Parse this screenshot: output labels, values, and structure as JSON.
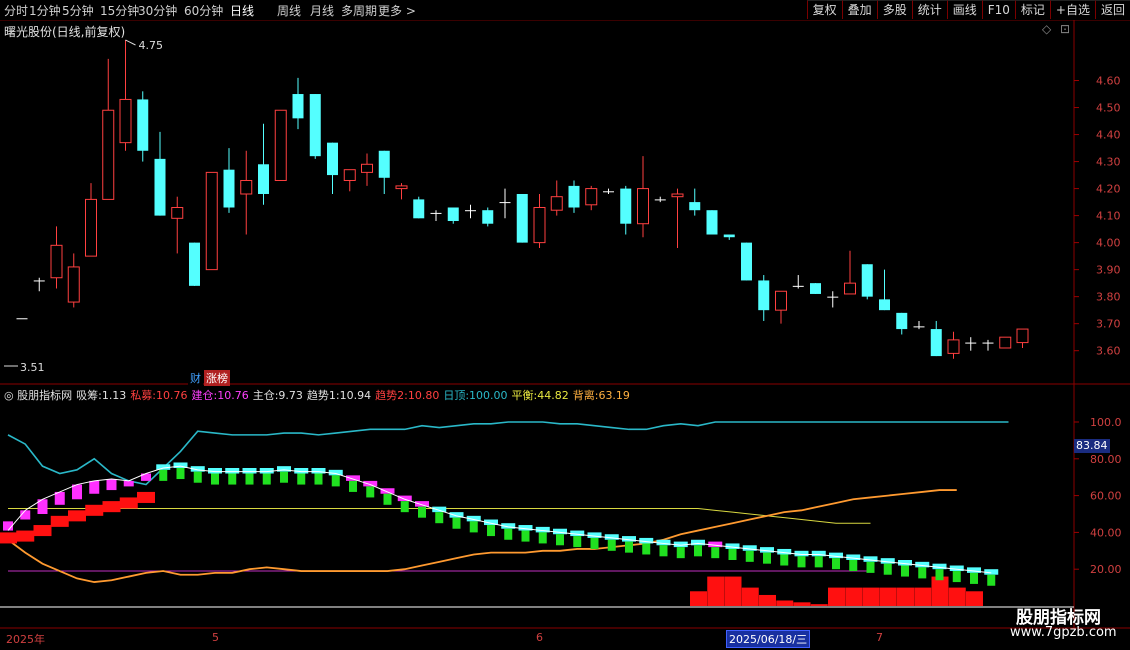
{
  "periods": [
    "分时",
    "1分钟",
    "5分钟",
    "15分钟",
    "30分钟",
    "60分钟",
    "日线",
    "周线",
    "月线",
    "多周期",
    "更多 >"
  ],
  "active_period": "日线",
  "right_buttons": [
    "复权",
    "叠加",
    "多股",
    "统计",
    "画线",
    "F10",
    "标记",
    "+自选",
    "返回"
  ],
  "title": "曙光股份(日线,前复权)",
  "title_controls": [
    "◇",
    "⊡"
  ],
  "price_axis": [
    "4.60",
    "4.50",
    "4.40",
    "4.30",
    "4.20",
    "4.10",
    "4.00",
    "3.90",
    "3.80",
    "3.70",
    "3.60"
  ],
  "high_marker": "4.75",
  "low_marker": "3.51",
  "badges": {
    "cai": "财",
    "zhangting": "涨榜"
  },
  "indicator": {
    "name": "股朋指标网",
    "items": [
      {
        "label": "吸筹:",
        "value": "1.13",
        "color": "#e0e0e0"
      },
      {
        "label": "私募:",
        "value": "10.76",
        "color": "#ff4040"
      },
      {
        "label": "建仓:",
        "value": "10.76",
        "color": "#ff40ff"
      },
      {
        "label": "主仓:",
        "value": "9.73",
        "color": "#e0e0e0"
      },
      {
        "label": "趋势1:",
        "value": "10.94",
        "color": "#e0e0e0"
      },
      {
        "label": "趋势2:",
        "value": "10.80",
        "color": "#ff4040"
      },
      {
        "label": "日顶:",
        "value": "100.00",
        "color": "#2ab8c8"
      },
      {
        "label": "平衡:",
        "value": "44.82",
        "color": "#e8e840"
      },
      {
        "label": "背离:",
        "value": "63.19",
        "color": "#ffb040"
      }
    ]
  },
  "ind_axis": [
    "100.0",
    "80.00",
    "60.00",
    "40.00",
    "20.00"
  ],
  "ind_current": "83.84",
  "x_labels": [
    {
      "text": "2025年"
    },
    {
      "text": "5"
    },
    {
      "text": "6"
    },
    {
      "text": "7"
    }
  ],
  "x_cursor_date": "2025/06/18/三",
  "watermark": {
    "line1": "股朋指标网",
    "line2": "www.7gpzb.com"
  },
  "chart_data": {
    "type": "candlestick",
    "y_range": [
      3.51,
      4.75
    ],
    "candles": [
      {
        "o": 3.72,
        "c": 3.72,
        "h": 3.72,
        "l": 3.72
      },
      {
        "o": 3.86,
        "c": 3.86,
        "h": 3.87,
        "l": 3.82
      },
      {
        "o": 3.87,
        "c": 3.99,
        "h": 4.06,
        "l": 3.83
      },
      {
        "o": 3.78,
        "c": 3.91,
        "h": 3.96,
        "l": 3.76
      },
      {
        "o": 3.95,
        "c": 4.16,
        "h": 4.22,
        "l": 3.95
      },
      {
        "o": 4.16,
        "c": 4.49,
        "h": 4.68,
        "l": 4.16
      },
      {
        "o": 4.37,
        "c": 4.53,
        "h": 4.75,
        "l": 4.34
      },
      {
        "o": 4.53,
        "c": 4.34,
        "h": 4.56,
        "l": 4.3
      },
      {
        "o": 4.31,
        "c": 4.1,
        "h": 4.41,
        "l": 4.1
      },
      {
        "o": 4.09,
        "c": 4.13,
        "h": 4.17,
        "l": 3.96
      },
      {
        "o": 4.0,
        "c": 3.84,
        "h": 4.0,
        "l": 3.84
      },
      {
        "o": 3.9,
        "c": 4.26,
        "h": 4.26,
        "l": 3.9
      },
      {
        "o": 4.27,
        "c": 4.13,
        "h": 4.35,
        "l": 4.11
      },
      {
        "o": 4.18,
        "c": 4.23,
        "h": 4.34,
        "l": 4.03
      },
      {
        "o": 4.29,
        "c": 4.18,
        "h": 4.44,
        "l": 4.14
      },
      {
        "o": 4.23,
        "c": 4.49,
        "h": 4.49,
        "l": 4.23
      },
      {
        "o": 4.55,
        "c": 4.46,
        "h": 4.61,
        "l": 4.42
      },
      {
        "o": 4.55,
        "c": 4.32,
        "h": 4.55,
        "l": 4.31
      },
      {
        "o": 4.37,
        "c": 4.25,
        "h": 4.37,
        "l": 4.18
      },
      {
        "o": 4.23,
        "c": 4.27,
        "h": 4.27,
        "l": 4.19
      },
      {
        "o": 4.26,
        "c": 4.29,
        "h": 4.33,
        "l": 4.21
      },
      {
        "o": 4.34,
        "c": 4.24,
        "h": 4.34,
        "l": 4.18
      },
      {
        "o": 4.2,
        "c": 4.21,
        "h": 4.22,
        "l": 4.16
      },
      {
        "o": 4.16,
        "c": 4.09,
        "h": 4.17,
        "l": 4.09
      },
      {
        "o": 4.11,
        "c": 4.11,
        "h": 4.12,
        "l": 4.08
      },
      {
        "o": 4.13,
        "c": 4.08,
        "h": 4.13,
        "l": 4.07
      },
      {
        "o": 4.12,
        "c": 4.12,
        "h": 4.14,
        "l": 4.09
      },
      {
        "o": 4.12,
        "c": 4.07,
        "h": 4.13,
        "l": 4.06
      },
      {
        "o": 4.15,
        "c": 4.15,
        "h": 4.2,
        "l": 4.09
      },
      {
        "o": 4.18,
        "c": 4.0,
        "h": 4.18,
        "l": 4.0
      },
      {
        "o": 4.0,
        "c": 4.13,
        "h": 4.18,
        "l": 3.98
      },
      {
        "o": 4.12,
        "c": 4.17,
        "h": 4.23,
        "l": 4.1
      },
      {
        "o": 4.21,
        "c": 4.13,
        "h": 4.23,
        "l": 4.11
      },
      {
        "o": 4.14,
        "c": 4.2,
        "h": 4.21,
        "l": 4.12
      },
      {
        "o": 4.19,
        "c": 4.19,
        "h": 4.2,
        "l": 4.18
      },
      {
        "o": 4.2,
        "c": 4.07,
        "h": 4.21,
        "l": 4.03
      },
      {
        "o": 4.07,
        "c": 4.2,
        "h": 4.32,
        "l": 4.02
      },
      {
        "o": 4.16,
        "c": 4.16,
        "h": 4.17,
        "l": 4.15
      },
      {
        "o": 4.17,
        "c": 4.18,
        "h": 4.2,
        "l": 3.98
      },
      {
        "o": 4.15,
        "c": 4.12,
        "h": 4.2,
        "l": 4.1
      },
      {
        "o": 4.12,
        "c": 4.03,
        "h": 4.12,
        "l": 4.03
      },
      {
        "o": 4.03,
        "c": 4.02,
        "h": 4.03,
        "l": 4.01
      },
      {
        "o": 4.0,
        "c": 3.86,
        "h": 4.0,
        "l": 3.86
      },
      {
        "o": 3.86,
        "c": 3.75,
        "h": 3.88,
        "l": 3.71
      },
      {
        "o": 3.75,
        "c": 3.82,
        "h": 3.82,
        "l": 3.7
      },
      {
        "o": 3.84,
        "c": 3.84,
        "h": 3.88,
        "l": 3.83
      },
      {
        "o": 3.85,
        "c": 3.81,
        "h": 3.85,
        "l": 3.81
      },
      {
        "o": 3.8,
        "c": 3.8,
        "h": 3.82,
        "l": 3.76
      },
      {
        "o": 3.81,
        "c": 3.85,
        "h": 3.97,
        "l": 3.81
      },
      {
        "o": 3.92,
        "c": 3.8,
        "h": 3.92,
        "l": 3.79
      },
      {
        "o": 3.79,
        "c": 3.75,
        "h": 3.9,
        "l": 3.75
      },
      {
        "o": 3.74,
        "c": 3.68,
        "h": 3.74,
        "l": 3.66
      },
      {
        "o": 3.69,
        "c": 3.69,
        "h": 3.71,
        "l": 3.68
      },
      {
        "o": 3.68,
        "c": 3.58,
        "h": 3.71,
        "l": 3.58
      },
      {
        "o": 3.59,
        "c": 3.64,
        "h": 3.67,
        "l": 3.57
      },
      {
        "o": 3.63,
        "c": 3.63,
        "h": 3.65,
        "l": 3.6
      },
      {
        "o": 3.63,
        "c": 3.63,
        "h": 3.64,
        "l": 3.6
      },
      {
        "o": 3.61,
        "c": 3.65,
        "h": 3.65,
        "l": 3.61
      },
      {
        "o": 3.63,
        "c": 3.68,
        "h": 3.68,
        "l": 3.61
      }
    ],
    "indicator_range": [
      0,
      100
    ],
    "ribbon_top": [
      41,
      52,
      58,
      62,
      66,
      68,
      69,
      68,
      72,
      75,
      76,
      74,
      73,
      73,
      73,
      73,
      74,
      73,
      73,
      72,
      69,
      66,
      62,
      58,
      55,
      52,
      49,
      47,
      45,
      43,
      42,
      41,
      40,
      39,
      38,
      37,
      36,
      35,
      34,
      33,
      34,
      33,
      32,
      31,
      30,
      29,
      28,
      28,
      27,
      26,
      25,
      24,
      23,
      22,
      21,
      20,
      19,
      18
    ],
    "ribbon_bottom": [
      46,
      47,
      50,
      55,
      58,
      61,
      63,
      65,
      68,
      70,
      71,
      73,
      71,
      71,
      71,
      71,
      71,
      72,
      72,
      71,
      70,
      68,
      64,
      60,
      55,
      50,
      45,
      42,
      39,
      36,
      35,
      34,
      33,
      32,
      32,
      32,
      33,
      33,
      32,
      32,
      33,
      33,
      31,
      27,
      24,
      23,
      22,
      21,
      21,
      21,
      21,
      20,
      20,
      19,
      18,
      17,
      16,
      15
    ],
    "cyan_line": [
      93,
      88,
      76,
      72,
      74,
      80,
      72,
      68,
      66,
      75,
      84,
      95,
      94,
      93,
      93,
      93,
      94,
      94,
      93,
      94,
      95,
      96,
      96,
      96,
      98,
      97,
      98,
      99,
      99,
      100,
      100,
      100,
      99,
      99,
      98,
      97,
      96,
      96,
      98,
      99,
      98,
      100,
      100,
      100,
      100,
      100,
      100,
      100,
      100,
      100,
      100,
      100,
      100,
      100,
      100,
      100,
      100,
      100,
      100
    ],
    "orange_line": [
      36,
      29,
      23,
      19,
      15,
      13,
      14,
      16,
      18,
      19,
      17,
      17,
      18,
      18,
      20,
      21,
      20,
      19,
      19,
      19,
      19,
      19,
      19,
      20,
      22,
      24,
      26,
      28,
      29,
      29,
      29,
      30,
      30,
      31,
      31,
      32,
      33,
      34,
      36,
      39,
      41,
      43,
      45,
      47,
      49,
      51,
      52,
      54,
      56,
      58,
      59,
      60,
      61,
      62,
      63,
      63
    ],
    "yellow_line": [
      53,
      53,
      53,
      53,
      53,
      53,
      53,
      53,
      53,
      53,
      53,
      53,
      53,
      53,
      53,
      53,
      53,
      53,
      53,
      53,
      53,
      53,
      53,
      53,
      53,
      53,
      53,
      53,
      53,
      53,
      53,
      53,
      53,
      53,
      53,
      53,
      53,
      53,
      53,
      53,
      53,
      52,
      51,
      50,
      49,
      48,
      47,
      46,
      45,
      45,
      45
    ],
    "magenta_line": [
      19,
      19,
      19,
      19,
      19,
      19,
      19,
      19,
      19,
      19,
      19,
      19,
      19,
      19,
      19,
      19,
      19,
      19,
      19,
      19,
      19,
      19,
      19,
      19,
      19,
      19,
      19,
      19,
      19,
      19,
      19,
      19,
      19,
      19,
      19,
      19,
      19,
      19,
      19,
      19,
      19,
      19,
      19,
      19,
      19,
      19,
      19,
      19,
      19,
      19,
      19
    ],
    "red_area": [
      {
        "i": 40,
        "v": 8
      },
      {
        "i": 41,
        "v": 16
      },
      {
        "i": 42,
        "v": 16
      },
      {
        "i": 43,
        "v": 10
      },
      {
        "i": 44,
        "v": 6
      },
      {
        "i": 45,
        "v": 3
      },
      {
        "i": 46,
        "v": 2
      },
      {
        "i": 47,
        "v": 1
      },
      {
        "i": 48,
        "v": 10
      },
      {
        "i": 49,
        "v": 10
      },
      {
        "i": 50,
        "v": 10
      },
      {
        "i": 51,
        "v": 10
      },
      {
        "i": 52,
        "v": 10
      },
      {
        "i": 53,
        "v": 10
      },
      {
        "i": 54,
        "v": 16
      },
      {
        "i": 55,
        "v": 10
      },
      {
        "i": 56,
        "v": 8
      }
    ]
  }
}
